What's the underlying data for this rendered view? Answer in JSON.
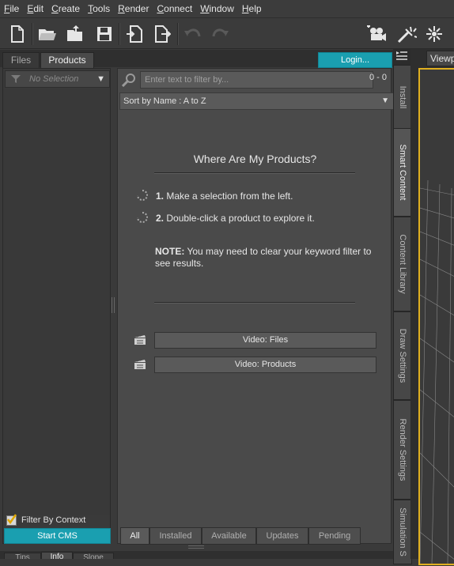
{
  "menu": [
    "File",
    "Edit",
    "Create",
    "Tools",
    "Render",
    "Connect",
    "Window",
    "Help"
  ],
  "toolbar": {
    "icons": [
      "new-file-icon",
      "open-folder-icon",
      "merge-folder-icon",
      "save-icon",
      "import-icon",
      "export-icon",
      "undo-icon",
      "redo-icon",
      "camera-icon",
      "spotlight-icon",
      "pointlight-icon"
    ]
  },
  "panel_tabs": {
    "files": "Files",
    "products": "Products",
    "login": "Login..."
  },
  "left": {
    "selection_placeholder": "No Selection",
    "filter_by_context": "Filter By Context",
    "start_cms": "Start CMS"
  },
  "search": {
    "placeholder": "Enter text to filter by...",
    "count": "0 - 0"
  },
  "sort": {
    "label": "Sort by Name : A to Z"
  },
  "help": {
    "title": "Where Are My Products?",
    "step1_num": "1.",
    "step1": "Make a selection from the left.",
    "step2_num": "2.",
    "step2": "Double-click a product to explore it.",
    "note_label": "NOTE:",
    "note": "You may need to clear your keyword filter to see results."
  },
  "videos": {
    "files": "Video: Files",
    "products": "Video: Products"
  },
  "bottom_tabs": [
    "All",
    "Installed",
    "Available",
    "Updates",
    "Pending"
  ],
  "side_tabs": [
    "Install",
    "Smart Content",
    "Content Library",
    "Draw Settings",
    "Render Settings",
    "Simulation S"
  ],
  "viewport": {
    "label": "Viewp"
  },
  "bottom_dock_tabs": [
    "Tips",
    "Info",
    "Slope"
  ],
  "colors": {
    "accent": "#1a9fb0",
    "viewport_frame": "#e0b020"
  }
}
